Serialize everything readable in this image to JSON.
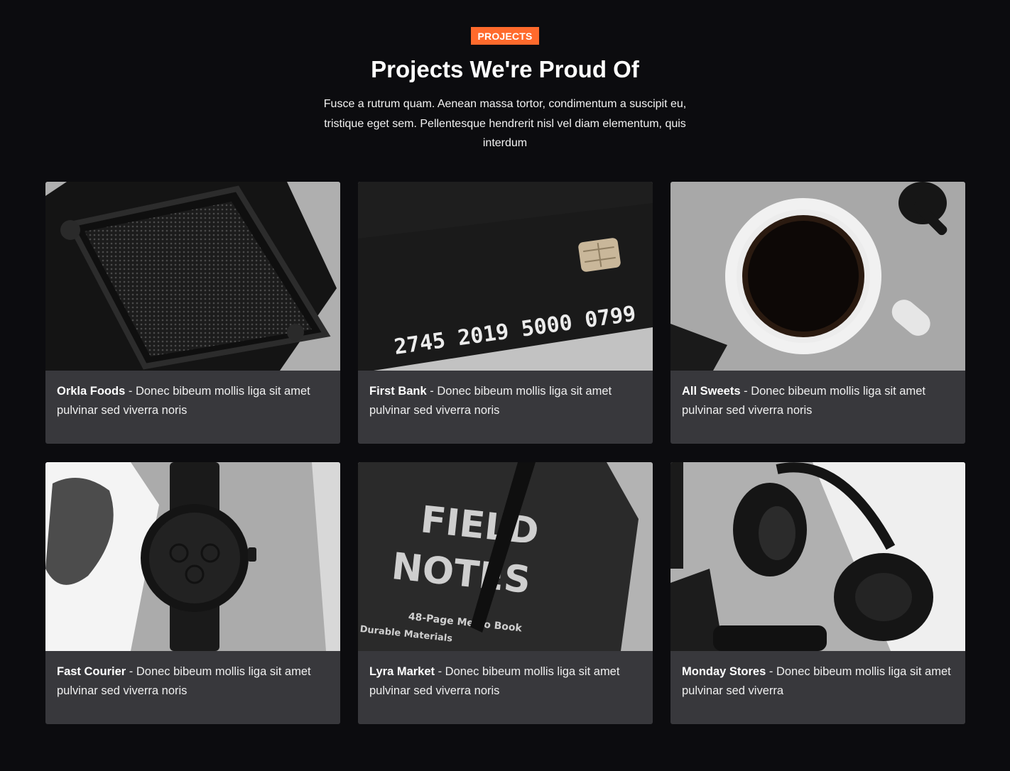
{
  "section": {
    "badge": "PROJECTS",
    "title": "Projects We're Proud Of",
    "intro_line1": "Fusce a rutrum quam. Aenean massa tortor, condimentum a suscipit eu,",
    "intro_line2": "tristique eget sem. Pellentesque hendrerit nisl vel diam elementum, quis",
    "intro_line3": "interdum"
  },
  "accent_color": "#ff6a2c",
  "projects": [
    {
      "name": "Orkla Foods",
      "desc": " - Donec bibeum mollis liga sit amet pulvinar sed viverra noris",
      "image": "speaker-photo"
    },
    {
      "name": "First Bank",
      "desc": " - Donec bibeum mollis liga sit amet pulvinar sed viverra noris",
      "image": "credit-card-photo",
      "card_number": "2745 2019 5000 0799"
    },
    {
      "name": "All Sweets",
      "desc": " - Donec bibeum mollis liga sit amet pulvinar sed viverra noris",
      "image": "coffee-cup-photo"
    },
    {
      "name": "Fast Courier",
      "desc": " - Donec bibeum mollis liga sit amet pulvinar sed viverra noris",
      "image": "wristwatch-photo"
    },
    {
      "name": "Lyra Market",
      "desc": " - Donec bibeum mollis liga sit amet pulvinar sed viverra noris",
      "image": "notebook-pen-photo",
      "notebook_text_1": "FIELD",
      "notebook_text_2": "NOTES",
      "notebook_text_3": "48-Page Memo Book",
      "notebook_text_4": "Durable Materials"
    },
    {
      "name": "Monday Stores",
      "desc": " - Donec bibeum mollis liga sit amet pulvinar sed viverra",
      "image": "headphones-photo"
    }
  ]
}
